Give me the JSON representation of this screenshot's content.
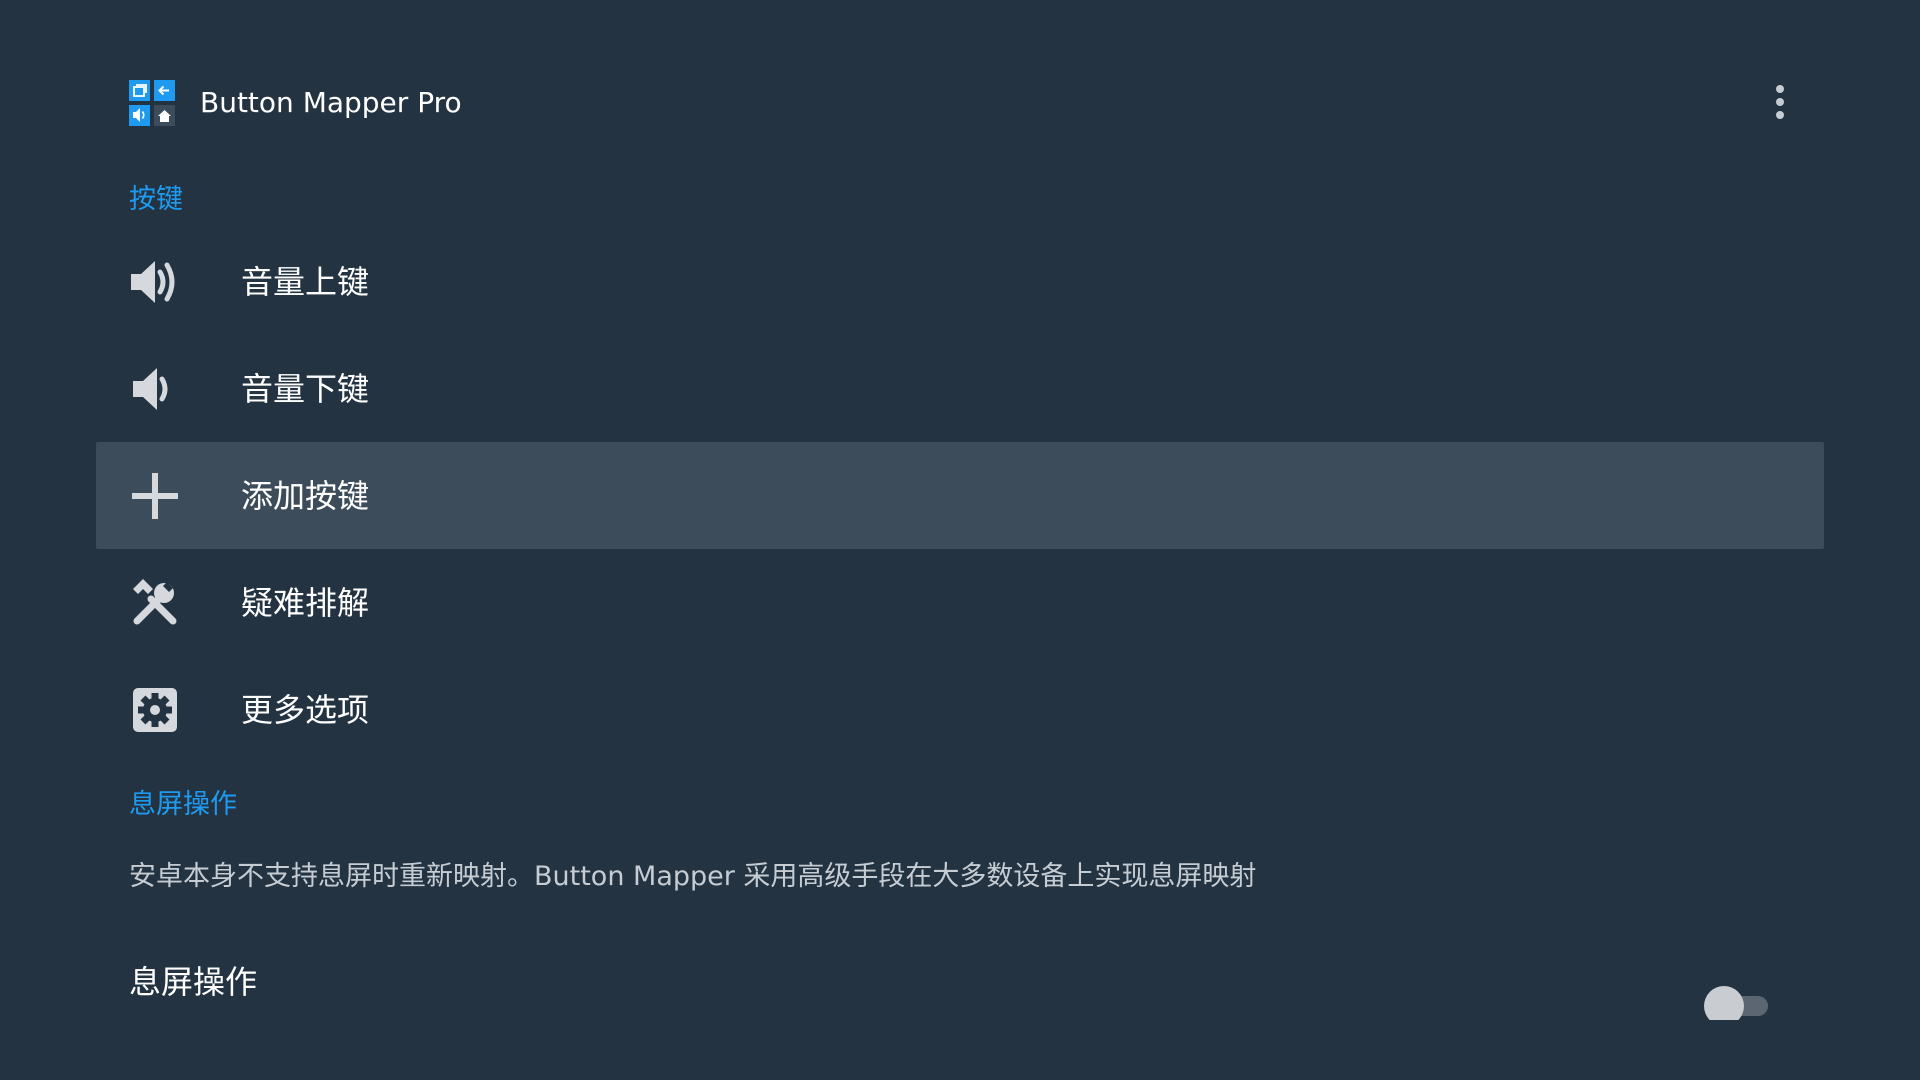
{
  "app": {
    "title": "Button Mapper Pro"
  },
  "sections": {
    "buttons_header": "按键",
    "screen_off_header": "息屏操作"
  },
  "menu": {
    "items": [
      {
        "label": "音量上键",
        "icon": "volume-up-icon"
      },
      {
        "label": "音量下键",
        "icon": "volume-down-icon"
      },
      {
        "label": "添加按键",
        "icon": "plus-icon",
        "focused": true
      },
      {
        "label": "疑难排解",
        "icon": "tools-icon"
      },
      {
        "label": "更多选项",
        "icon": "gear-icon"
      }
    ]
  },
  "screen_off": {
    "description": "安卓本身不支持息屏时重新映射。Button Mapper 采用高级手段在大多数设备上实现息屏映射",
    "toggle_label": "息屏操作",
    "toggle_on": false
  },
  "colors": {
    "background": "#233342",
    "accent": "#1e9bf0",
    "focus_row": "#3d4c5a",
    "icon": "#d5d9dd"
  }
}
